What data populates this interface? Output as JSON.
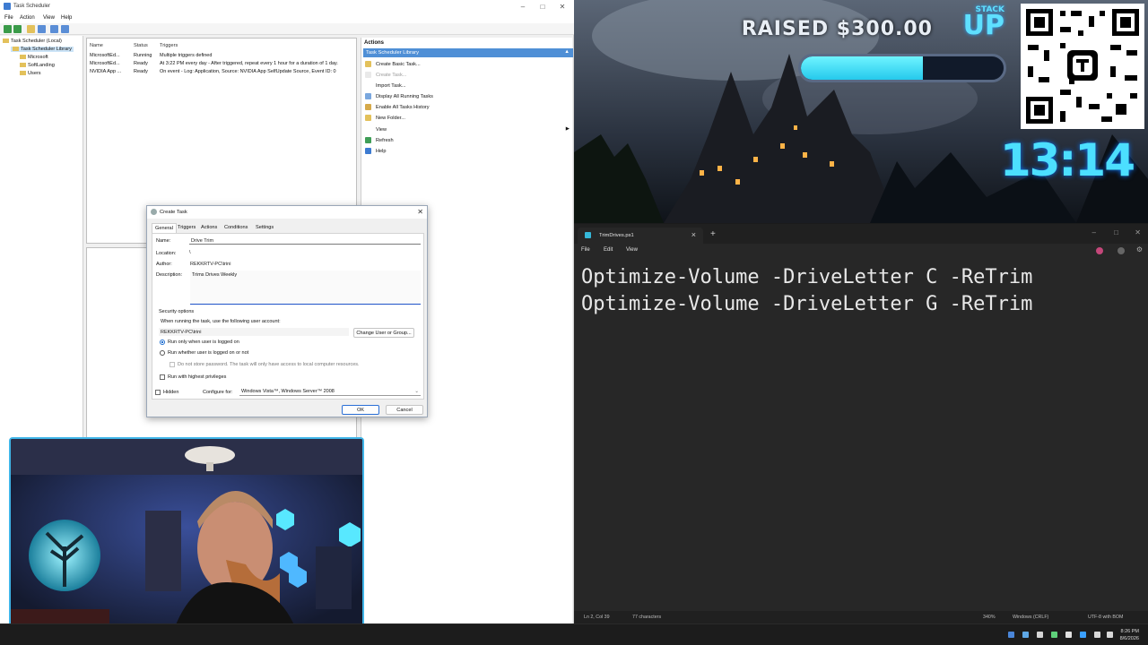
{
  "task_scheduler": {
    "title": "Task Scheduler",
    "menu": [
      "File",
      "Action",
      "View",
      "Help"
    ],
    "tree": {
      "root": "Task Scheduler (Local)",
      "library": "Task Scheduler Library",
      "children": [
        "Microsoft",
        "SoftLanding",
        "Users"
      ]
    },
    "list": {
      "columns": [
        "Name",
        "Status",
        "Triggers"
      ],
      "rows": [
        {
          "name": "MicrosoftEd...",
          "status": "Running",
          "triggers": "Multiple triggers defined"
        },
        {
          "name": "MicrosoftEd...",
          "status": "Ready",
          "triggers": "At 3:22 PM every day - After triggered, repeat every 1 hour for a duration of 1 day."
        },
        {
          "name": "NVIDIA App ...",
          "status": "Ready",
          "triggers": "On event - Log: Application, Source: NVIDIA App SelfUpdate Source, Event ID: 0"
        }
      ]
    },
    "actions": {
      "header": "Actions",
      "section": "Task Scheduler Library",
      "items": [
        {
          "label": "Create Basic Task...",
          "icon": "wand-icon",
          "enabled": true
        },
        {
          "label": "Create Task...",
          "icon": "task-icon",
          "enabled": false
        },
        {
          "label": "Import Task...",
          "icon": "blank-icon",
          "enabled": true
        },
        {
          "label": "Display All Running Tasks",
          "icon": "list-icon",
          "enabled": true
        },
        {
          "label": "Enable All Tasks History",
          "icon": "history-icon",
          "enabled": true
        },
        {
          "label": "New Folder...",
          "icon": "folder-icon",
          "enabled": true
        },
        {
          "label": "View",
          "icon": "blank-icon",
          "enabled": true
        },
        {
          "label": "Refresh",
          "icon": "refresh-icon",
          "enabled": true
        },
        {
          "label": "Help",
          "icon": "help-icon",
          "enabled": true
        }
      ]
    }
  },
  "create_task": {
    "title": "Create Task",
    "tabs": [
      "General",
      "Triggers",
      "Actions",
      "Conditions",
      "Settings"
    ],
    "name_label": "Name:",
    "name_value": "Drive Trim",
    "location_label": "Location:",
    "location_value": "\\",
    "author_label": "Author:",
    "author_value": "REKKRTV-PC\\trini",
    "description_label": "Description:",
    "description_value": "Trims Drives Weekly",
    "security_header": "Security options",
    "account_prompt": "When running the task, use the following user account:",
    "account_value": "REKKRTV-PC\\trini",
    "change_user_button": "Change User or Group...",
    "radio_logged_on": "Run only when user is logged on",
    "radio_whether": "Run whether user is logged on or not",
    "no_password": "Do not store password.  The task will only have access to local computer resources.",
    "highest_priv": "Run with highest privileges",
    "hidden": "Hidden",
    "configure_label": "Configure for:",
    "configure_value": "Windows Vista™, Windows Server™ 2008",
    "ok": "OK",
    "cancel": "Cancel"
  },
  "overlay": {
    "raised": "RAISED $300.00",
    "logo_top": "STACK",
    "logo_bottom": "UP",
    "progress": 0.6,
    "timer": "13:14"
  },
  "notepad": {
    "tab_title": "TrimDrives.ps1",
    "menu": [
      "File",
      "Edit",
      "View"
    ],
    "lines": [
      "Optimize-Volume -DriveLetter C -ReTrim",
      "Optimize-Volume -DriveLetter G -ReTrim"
    ],
    "status": {
      "position": "Ln 2, Col 39",
      "chars": "77 characters",
      "zoom": "340%",
      "eol": "Windows (CRLF)",
      "encoding": "UTF-8 with BOM"
    }
  },
  "taskbar": {
    "time": "8:26 PM",
    "date": "8/6/2026"
  },
  "colors": {
    "accent": "#1f6fd1",
    "overlay_cyan": "#4cdfff",
    "notepad_bg": "#272727"
  }
}
